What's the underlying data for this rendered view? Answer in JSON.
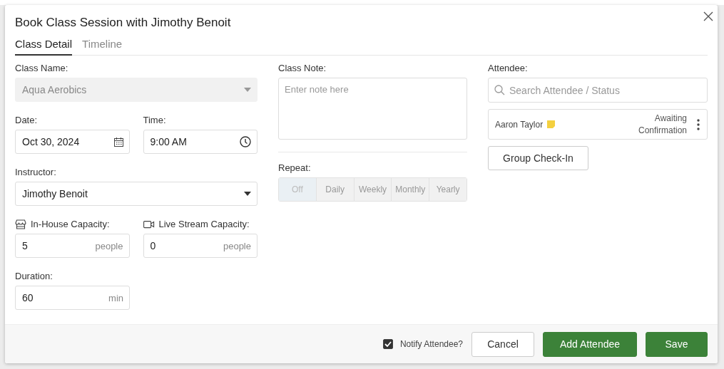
{
  "dialog": {
    "title": "Book Class Session with Jimothy Benoit"
  },
  "tabs": [
    {
      "label": "Class Detail",
      "selected": true
    },
    {
      "label": "Timeline",
      "selected": false
    }
  ],
  "class_name": {
    "label": "Class Name:",
    "value": "Aqua Aerobics",
    "disabled": true
  },
  "date": {
    "label": "Date:",
    "value": "Oct 30, 2024"
  },
  "time": {
    "label": "Time:",
    "value": "9:00 AM"
  },
  "instructor": {
    "label": "Instructor:",
    "value": "Jimothy Benoit",
    "disabled": false
  },
  "in_house_capacity": {
    "label": "In-House Capacity:",
    "value": "5",
    "unit": "people"
  },
  "live_stream_capacity": {
    "label": "Live Stream Capacity:",
    "value": "0",
    "unit": "people"
  },
  "duration": {
    "label": "Duration:",
    "value": "60",
    "unit": "min"
  },
  "class_note": {
    "label": "Class Note:",
    "placeholder": "Enter note here"
  },
  "repeat": {
    "label": "Repeat:",
    "disabled": true,
    "options": [
      {
        "label": "Off",
        "selected": true
      },
      {
        "label": "Daily",
        "selected": false
      },
      {
        "label": "Weekly",
        "selected": false
      },
      {
        "label": "Monthly",
        "selected": false
      },
      {
        "label": "Yearly",
        "selected": false
      }
    ]
  },
  "attendee": {
    "label": "Attendee:",
    "search_placeholder": "Search Attendee / Status",
    "items": [
      {
        "name": "Aaron Taylor",
        "has_note": true,
        "status": "Awaiting Confirmation"
      }
    ]
  },
  "group_check_in": "Group Check-In",
  "footer": {
    "notify": {
      "label": "Notify Attendee?",
      "checked": true
    },
    "buttons": [
      {
        "label": "Cancel",
        "kind": "secondary"
      },
      {
        "label": "Add Attendee",
        "kind": "primary"
      },
      {
        "label": "Save",
        "kind": "primary"
      }
    ]
  }
}
